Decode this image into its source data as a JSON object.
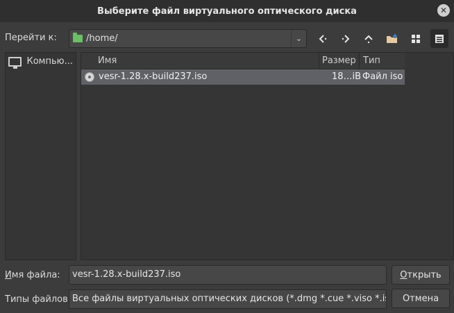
{
  "window": {
    "title": "Выберите файл виртуального оптического диска"
  },
  "toolbar": {
    "goto_label": "Перейти к:",
    "path": "/home/",
    "icons": [
      "back-arrow-icon",
      "forward-arrow-icon",
      "up-arrow-icon",
      "new-folder-icon",
      "icon-view-icon",
      "list-view-icon"
    ]
  },
  "sidebar": {
    "items": [
      {
        "label": "Компью..."
      }
    ]
  },
  "table": {
    "columns": [
      "Имя",
      "Размер",
      "Тип"
    ],
    "rows": [
      {
        "name": "vesr-1.28.x-build237.iso",
        "size": "18…iB",
        "type": "Файл iso"
      }
    ]
  },
  "form": {
    "filename_label_accel": "И",
    "filename_label_rest": "мя файла:",
    "filename_value": "vesr-1.28.x-build237.iso",
    "filetype_label": "Типы файлов:",
    "filetype_value": "Все файлы виртуальных оптических дисков (*.dmg *.cue *.viso *.iso *.ccd *.mds *.mdf)",
    "open_accel": "О",
    "open_rest": "ткрыть",
    "cancel_label": "Отмена"
  },
  "colors": {
    "selected_row": "#5f6166",
    "folder": "#6cbf66",
    "background": "#3c3c3c"
  }
}
